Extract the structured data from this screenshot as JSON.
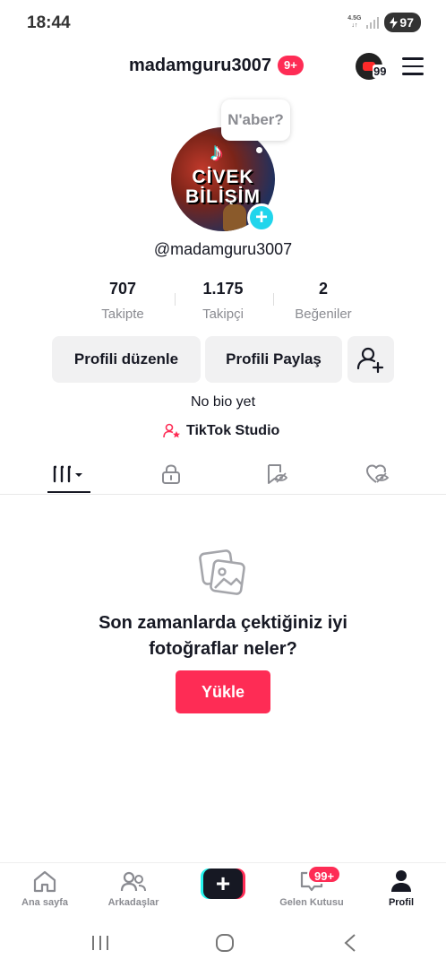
{
  "status_bar": {
    "time": "18:44",
    "network": "4.5G",
    "battery": "97"
  },
  "header": {
    "username": "madamguru3007",
    "badge": "9+",
    "yt_count": "99"
  },
  "profile": {
    "bubble_text": "N'aber?",
    "avatar_line1": "CİVEK",
    "avatar_line2": "BİLİŞİM",
    "handle": "@madamguru3007",
    "bio": "No bio yet",
    "studio_label": "TikTok Studio"
  },
  "stats": [
    {
      "value": "707",
      "label": "Takipte"
    },
    {
      "value": "1.175",
      "label": "Takipçi"
    },
    {
      "value": "2",
      "label": "Beğeniler"
    }
  ],
  "buttons": {
    "edit_profile": "Profili düzenle",
    "share_profile": "Profili Paylaş"
  },
  "tabs": [
    "videos-grid-icon",
    "lock-icon",
    "saved-icon",
    "liked-icon"
  ],
  "empty_state": {
    "title_line1": "Son zamanlarda çektiğiniz iyi",
    "title_line2": "fotoğraflar neler?",
    "upload_label": "Yükle"
  },
  "bottom_nav": {
    "home": "Ana sayfa",
    "friends": "Arkadaşlar",
    "inbox": "Gelen Kutusu",
    "inbox_badge": "99+",
    "profile": "Profil"
  },
  "colors": {
    "accent": "#fe2c55",
    "cyan": "#25f4ee",
    "text": "#161823",
    "muted": "#8a8b91"
  }
}
